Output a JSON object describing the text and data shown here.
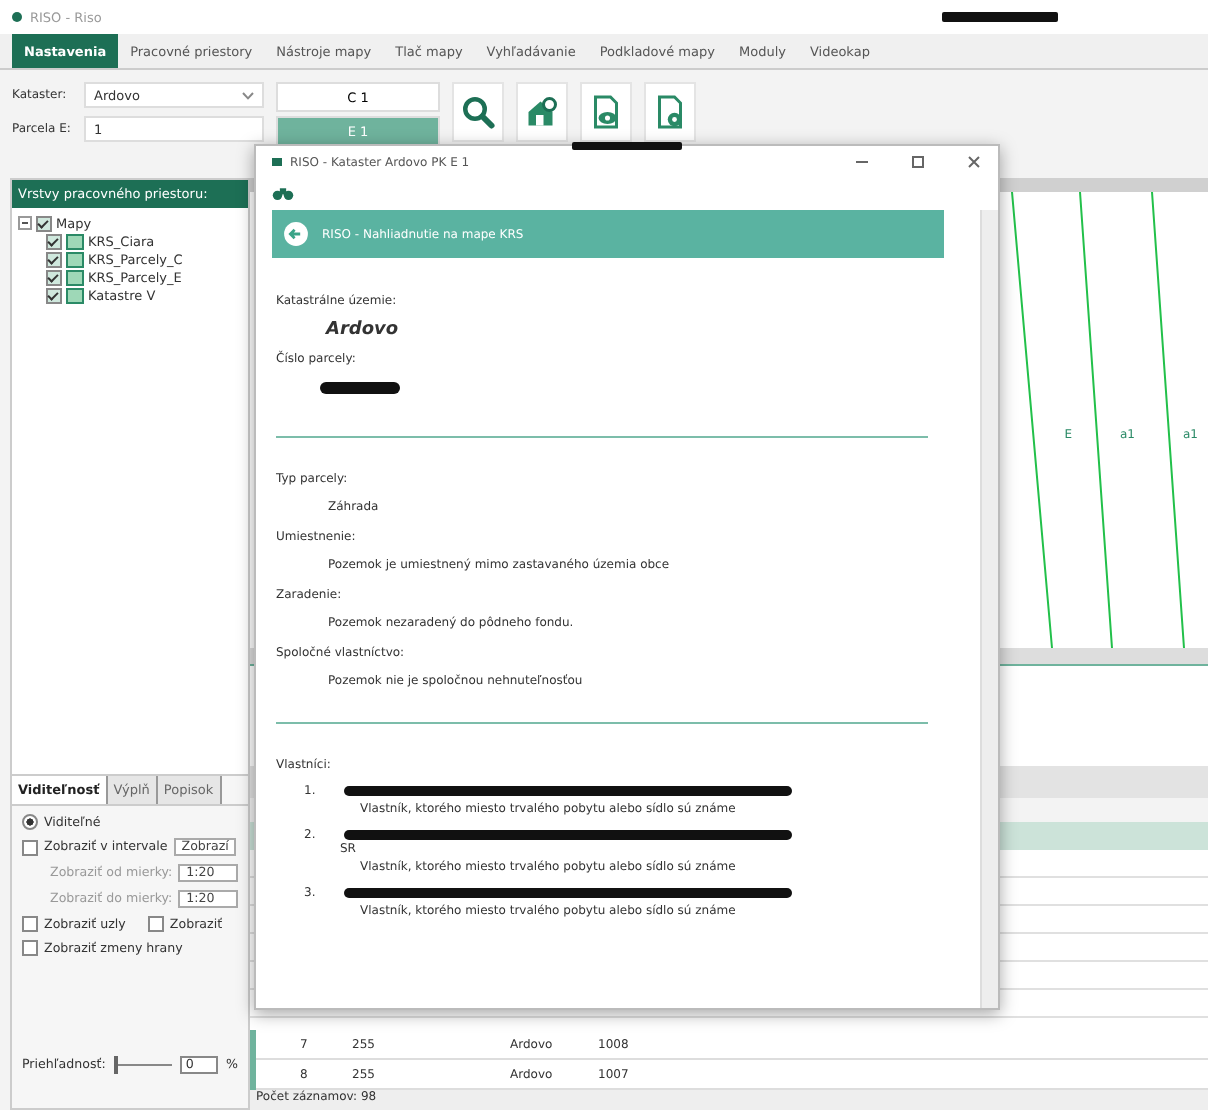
{
  "app": {
    "title": "RISO - Riso"
  },
  "tabs": [
    {
      "label": "Nastavenia",
      "selected": true
    },
    {
      "label": "Pracovné priestory",
      "selected": false
    },
    {
      "label": "Nástroje mapy",
      "selected": false
    },
    {
      "label": "Tlač mapy",
      "selected": false
    },
    {
      "label": "Vyhľadávanie",
      "selected": false
    },
    {
      "label": "Podkladové mapy",
      "selected": false
    },
    {
      "label": "Moduly",
      "selected": false
    },
    {
      "label": "Videokap",
      "selected": false
    }
  ],
  "search": {
    "fields": [
      {
        "label": "Kataster:",
        "value": "Ardovo",
        "kind": "dropdown"
      },
      {
        "label": "Parcela E:",
        "value": "1",
        "kind": "text"
      }
    ],
    "buttons": [
      {
        "label": "C 1",
        "selected": false
      },
      {
        "label": "E 1",
        "selected": true
      }
    ]
  },
  "layers": {
    "title": "Vrstvy pracovného priestoru:",
    "tree": [
      {
        "label": "Mapy",
        "expanded": true,
        "checked": true,
        "children": [
          {
            "label": "KRS_Ciara",
            "checked": true
          },
          {
            "label": "KRS_Parcely_C",
            "checked": true
          },
          {
            "label": "KRS_Parcely_E",
            "checked": true
          },
          {
            "label": "Katastre V",
            "checked": true
          }
        ]
      }
    ]
  },
  "properties": {
    "tabs": [
      {
        "label": "Viditeľnosť",
        "selected": true
      },
      {
        "label": "Výplň",
        "selected": false
      },
      {
        "label": "Popisok",
        "selected": false
      }
    ],
    "options": [
      {
        "kind": "radio",
        "label": "Viditeľné",
        "checked": true
      },
      {
        "kind": "checkbox",
        "label": "Zobraziť v intervale",
        "checked": false,
        "value": "Zobrazí"
      },
      {
        "kind": "scale",
        "label": "Zobraziť od mierky:",
        "value": "1:20"
      },
      {
        "kind": "scale",
        "label": "Zobraziť do mierky:",
        "value": "1:20"
      },
      {
        "kind": "pair",
        "label": "Zobraziť uzly",
        "checked": false,
        "label_2": "Zobraziť",
        "checked_2": false
      },
      {
        "kind": "checkbox",
        "label": "Zobraziť zmeny hrany",
        "checked": false
      }
    ],
    "transparency": {
      "label": "Priehľadnosť:",
      "value": "0",
      "unit": "%",
      "level": 0
    }
  },
  "map": {
    "parcel_labels": [
      "E",
      "a1",
      "a1"
    ]
  },
  "table": {
    "rows": [
      [
        "7",
        "255",
        "Ardovo",
        "1008"
      ],
      [
        "8",
        "255",
        "Ardovo",
        "1007"
      ]
    ],
    "status": "Počet záznamov: 98"
  },
  "dialog": {
    "title": "RISO - Kataster Ardovo PK E 1",
    "banner": "RISO - Nahliadnutie na mape KRS",
    "fields": [
      {
        "label": "Katastrálne územie:",
        "value": "Ardovo",
        "kind": "emphasis"
      },
      {
        "label": "Číslo parcely:",
        "kind": "redacted"
      },
      {
        "kind": "divider"
      },
      {
        "label": "Typ parcely:",
        "value": "Záhrada",
        "kind": "text"
      },
      {
        "label": "Umiestnenie:",
        "value": "Pozemok je umiestnený mimo zastavaného územia obce",
        "kind": "text"
      },
      {
        "label": "Zaradenie:",
        "value": "Pozemok nezaradený do pôdneho fondu.",
        "kind": "text"
      },
      {
        "label": "Spoločné vlastníctvo:",
        "value": "Pozemok nie je spoločnou nehnuteľnosťou",
        "kind": "text"
      },
      {
        "kind": "divider"
      }
    ],
    "owners_label": "Vlastníci:",
    "owners": [
      {
        "number": "1.",
        "note": "Vlastník, ktorého miesto trvalého pobytu alebo sídlo sú známe"
      },
      {
        "number": "2.",
        "extra": "SR",
        "note": "Vlastník, ktorého miesto trvalého pobytu alebo sídlo sú známe"
      },
      {
        "number": "3.",
        "note": "Vlastník, ktorého miesto trvalého pobytu alebo sídlo sú známe"
      }
    ]
  }
}
